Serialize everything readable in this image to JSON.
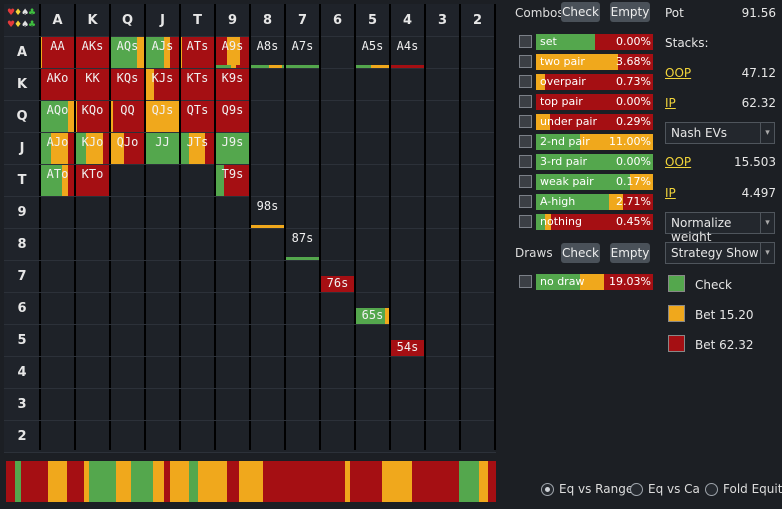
{
  "matrix": {
    "ranks": [
      "A",
      "K",
      "Q",
      "J",
      "T",
      "9",
      "8",
      "7",
      "6",
      "5",
      "4",
      "3",
      "2"
    ],
    "suits": [
      {
        "sym": "♥",
        "color": "#e43a3a"
      },
      {
        "sym": "♦",
        "color": "#f1d43a"
      },
      {
        "sym": "♠",
        "color": "#e0e0e0"
      },
      {
        "sym": "♣",
        "color": "#3fbf3f"
      }
    ],
    "hands": [
      {
        "label": "AA",
        "r": 0,
        "c": 0,
        "segs": [
          [
            "o",
            0.06
          ],
          [
            "r",
            0.94
          ]
        ]
      },
      {
        "label": "AKs",
        "r": 0,
        "c": 1,
        "segs": [
          [
            "r",
            1
          ]
        ]
      },
      {
        "label": "AQs",
        "r": 0,
        "c": 2,
        "segs": [
          [
            "g",
            0.78
          ],
          [
            "o",
            0.22
          ]
        ]
      },
      {
        "label": "AJs",
        "r": 0,
        "c": 3,
        "segs": [
          [
            "g",
            0.55
          ],
          [
            "o",
            0.15
          ],
          [
            "r",
            0.3
          ]
        ]
      },
      {
        "label": "ATs",
        "r": 0,
        "c": 4,
        "segs": [
          [
            "o",
            0.05
          ],
          [
            "r",
            0.95
          ]
        ]
      },
      {
        "label": "A9s",
        "r": 0,
        "c": 5,
        "segs": [
          [
            "r",
            0.35
          ],
          [
            "o",
            0.35
          ],
          [
            "r",
            0.3
          ]
        ],
        "strip": [
          [
            "g",
            0.45
          ],
          [
            "o",
            0.15
          ],
          [
            "r",
            0.4
          ]
        ]
      },
      {
        "label": "A8s",
        "r": 0,
        "c": 6,
        "strip": [
          [
            "g",
            0.55
          ],
          [
            "o",
            0.35
          ],
          [
            "g",
            0.1
          ]
        ]
      },
      {
        "label": "A7s",
        "r": 0,
        "c": 7,
        "strip": [
          [
            "g",
            1
          ]
        ]
      },
      {
        "label": "A5s",
        "r": 0,
        "c": 9,
        "strip": [
          [
            "g",
            0.45
          ],
          [
            "o",
            0.55
          ]
        ]
      },
      {
        "label": "A4s",
        "r": 0,
        "c": 10,
        "strip": [
          [
            "r",
            1
          ]
        ]
      },
      {
        "label": "AKo",
        "r": 1,
        "c": 0,
        "segs": [
          [
            "r",
            1
          ]
        ]
      },
      {
        "label": "KK",
        "r": 1,
        "c": 1,
        "segs": [
          [
            "r",
            1
          ]
        ]
      },
      {
        "label": "KQs",
        "r": 1,
        "c": 2,
        "segs": [
          [
            "r",
            1
          ]
        ]
      },
      {
        "label": "KJs",
        "r": 1,
        "c": 3,
        "segs": [
          [
            "o",
            0.25
          ],
          [
            "r",
            0.75
          ]
        ]
      },
      {
        "label": "KTs",
        "r": 1,
        "c": 4,
        "segs": [
          [
            "r",
            1
          ]
        ]
      },
      {
        "label": "K9s",
        "r": 1,
        "c": 5,
        "segs": [
          [
            "r",
            1
          ]
        ]
      },
      {
        "label": "AQo",
        "r": 2,
        "c": 0,
        "segs": [
          [
            "g",
            0.8
          ],
          [
            "o",
            0.2
          ]
        ]
      },
      {
        "label": "KQo",
        "r": 2,
        "c": 1,
        "segs": [
          [
            "o",
            0.06
          ],
          [
            "r",
            0.94
          ]
        ]
      },
      {
        "label": "QQ",
        "r": 2,
        "c": 2,
        "segs": [
          [
            "o",
            0.08
          ],
          [
            "r",
            0.92
          ]
        ]
      },
      {
        "label": "QJs",
        "r": 2,
        "c": 3,
        "segs": [
          [
            "o",
            1
          ]
        ]
      },
      {
        "label": "QTs",
        "r": 2,
        "c": 4,
        "segs": [
          [
            "r",
            1
          ]
        ]
      },
      {
        "label": "Q9s",
        "r": 2,
        "c": 5,
        "segs": [
          [
            "r",
            1
          ]
        ]
      },
      {
        "label": "AJo",
        "r": 3,
        "c": 0,
        "segs": [
          [
            "g",
            0.32
          ],
          [
            "o",
            0.48
          ],
          [
            "r",
            0.2
          ]
        ]
      },
      {
        "label": "KJo",
        "r": 3,
        "c": 1,
        "segs": [
          [
            "g",
            0.3
          ],
          [
            "o",
            0.5
          ],
          [
            "r",
            0.2
          ]
        ]
      },
      {
        "label": "QJo",
        "r": 3,
        "c": 2,
        "segs": [
          [
            "o",
            0.4
          ],
          [
            "r",
            0.6
          ]
        ]
      },
      {
        "label": "JJ",
        "r": 3,
        "c": 3,
        "segs": [
          [
            "g",
            1
          ]
        ]
      },
      {
        "label": "JTs",
        "r": 3,
        "c": 4,
        "segs": [
          [
            "g",
            0.25
          ],
          [
            "o",
            0.45
          ],
          [
            "r",
            0.3
          ]
        ]
      },
      {
        "label": "J9s",
        "r": 3,
        "c": 5,
        "segs": [
          [
            "g",
            1
          ]
        ]
      },
      {
        "label": "ATo",
        "r": 4,
        "c": 0,
        "segs": [
          [
            "g",
            0.62
          ],
          [
            "o",
            0.18
          ],
          [
            "r",
            0.2
          ]
        ]
      },
      {
        "label": "KTo",
        "r": 4,
        "c": 1,
        "segs": [
          [
            "r",
            1
          ]
        ]
      },
      {
        "label": "T9s",
        "r": 4,
        "c": 5,
        "segs": [
          [
            "g",
            0.25
          ],
          [
            "r",
            0.75
          ]
        ]
      },
      {
        "label": "98s",
        "r": 5,
        "c": 6,
        "strip": [
          [
            "o",
            1
          ]
        ]
      },
      {
        "label": "87s",
        "r": 6,
        "c": 7,
        "strip": [
          [
            "g",
            1
          ]
        ]
      },
      {
        "label": "76s",
        "r": 7,
        "c": 8,
        "full": [
          [
            "r",
            1
          ]
        ]
      },
      {
        "label": "65s",
        "r": 8,
        "c": 9,
        "full": [
          [
            "g",
            0.85
          ],
          [
            "o",
            0.15
          ]
        ]
      },
      {
        "label": "54s",
        "r": 9,
        "c": 10,
        "full": [
          [
            "r",
            1
          ]
        ]
      }
    ]
  },
  "strategy_bar": [
    [
      "r",
      0.018
    ],
    [
      "g",
      0.012
    ],
    [
      "r",
      0.055
    ],
    [
      "o",
      0.04
    ],
    [
      "r",
      0.035
    ],
    [
      "o",
      0.01
    ],
    [
      "g",
      0.055
    ],
    [
      "o",
      0.03
    ],
    [
      "g",
      0.045
    ],
    [
      "o",
      0.022
    ],
    [
      "r",
      0.012
    ],
    [
      "o",
      0.04
    ],
    [
      "g",
      0.018
    ],
    [
      "o",
      0.06
    ],
    [
      "r",
      0.024
    ],
    [
      "o",
      0.048
    ],
    [
      "r",
      0.168
    ],
    [
      "o",
      0.01
    ],
    [
      "r",
      0.065
    ],
    [
      "o",
      0.062
    ],
    [
      "r",
      0.096
    ],
    [
      "g",
      0.04
    ],
    [
      "o",
      0.02
    ],
    [
      "r",
      0.015
    ]
  ],
  "colors": {
    "g": "#54a74d",
    "o": "#f0a81c",
    "r": "#a50f13"
  },
  "combos": {
    "title": "Combos",
    "check_btn": "Check",
    "empty_btn": "Empty",
    "rows": [
      {
        "name": "set",
        "pct": "0.00%",
        "green": 0.5,
        "orange": 0.0
      },
      {
        "name": "two pair",
        "pct": "3.68%",
        "green": 0.0,
        "orange": 0.7
      },
      {
        "name": "overpair",
        "pct": "0.73%",
        "green": 0.0,
        "orange": 0.08
      },
      {
        "name": "top pair",
        "pct": "0.00%",
        "green": 0.0,
        "orange": 0.0
      },
      {
        "name": "under pair",
        "pct": "0.29%",
        "green": 0.0,
        "orange": 0.12
      },
      {
        "name": "2-nd pair",
        "pct": "11.00%",
        "green": 0.38,
        "orange": 0.62
      },
      {
        "name": "3-rd pair",
        "pct": "0.00%",
        "green": 1.0,
        "orange": 0.0
      },
      {
        "name": "weak pair",
        "pct": "0.17%",
        "green": 0.8,
        "orange": 0.2
      },
      {
        "name": "A-high",
        "pct": "2.71%",
        "green": 0.62,
        "orange": 0.12
      },
      {
        "name": "nothing",
        "pct": "0.45%",
        "green": 0.08,
        "orange": 0.05
      }
    ]
  },
  "draws": {
    "title": "Draws",
    "check_btn": "Check",
    "empty_btn": "Empty",
    "rows": [
      {
        "name": "no draw",
        "pct": "19.03%",
        "green": 0.38,
        "orange": 0.2
      }
    ]
  },
  "info": {
    "pot_label": "Pot",
    "pot_value": "91.56",
    "stacks_label": "Stacks:",
    "oop_label": "OOP",
    "oop_stack": "47.12",
    "ip_label": "IP",
    "ip_stack": "62.32",
    "ev_select": "Nash EVs",
    "oop_ev": "15.503",
    "ip_ev": "4.497",
    "weight_select": "Normalize weight",
    "strategy_select": "Strategy Show",
    "legend": [
      {
        "label": "Check",
        "color": "#54a74d"
      },
      {
        "label": "Bet 15.20",
        "color": "#f0a81c"
      },
      {
        "label": "Bet 62.32",
        "color": "#a50f13"
      }
    ]
  },
  "radios": [
    {
      "label": "Eq vs Range",
      "selected": true
    },
    {
      "label": "Eq vs Ca",
      "selected": false
    },
    {
      "label": "Fold Equity",
      "selected": false
    }
  ]
}
